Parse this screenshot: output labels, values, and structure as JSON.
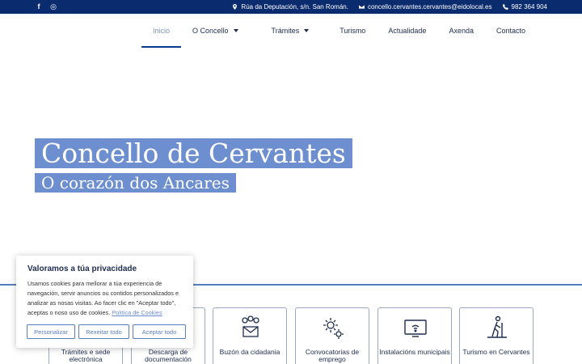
{
  "topbar": {
    "social": [
      {
        "icon": "facebook-icon",
        "glyph": "f"
      },
      {
        "icon": "whatsapp-icon",
        "glyph": "◎"
      }
    ],
    "address": "Rúa da Deputación, s/n. San Román.",
    "email": "concello.cervantes.cervantes@eidolocal.es",
    "phone": "982 364 904"
  },
  "nav": {
    "items": [
      {
        "label": "Inicio",
        "active": true
      },
      {
        "label": "O Concello",
        "dropdown": true
      },
      {
        "label": "Trámites",
        "dropdown": true
      },
      {
        "label": "Turismo"
      },
      {
        "label": "Actualidade"
      },
      {
        "label": "Axenda"
      },
      {
        "label": "Contacto"
      }
    ]
  },
  "hero": {
    "title": "Concello de Cervantes",
    "subtitle": "O corazón dos Ancares"
  },
  "services": [
    {
      "label": "Trámites e sede electrónica",
      "icon": "document-icon"
    },
    {
      "label": "Descarga de documentación",
      "icon": "download-icon"
    },
    {
      "label": "Buzón da cidadania",
      "icon": "mailbox-icon"
    },
    {
      "label": "Convocatorias de emprego",
      "icon": "gear-icon"
    },
    {
      "label": "Instalacións municipais",
      "icon": "monitor-icon"
    },
    {
      "label": "Turismo en Cervantes",
      "icon": "hiker-icon"
    }
  ],
  "cookie": {
    "title": "Valoramos a túa privacidade",
    "text": "Usamos cookies para mellorar a túa experiencia de navegación, servir anuncios ou contidos personalizados e analizar as nosas visitas. Ao facer clic en \"Aceptar todo\", aceptas o noso uso de cookies.",
    "link": "Política de Cookies",
    "customize": "Personalizar",
    "reject": "Rexeitar todo",
    "accept": "Aceptar todo"
  },
  "colors": {
    "topbar": "#0a2b6d",
    "accent": "#6d8fd0",
    "nav_text": "#1d2c4e",
    "nav_active": "#7d93b5"
  }
}
